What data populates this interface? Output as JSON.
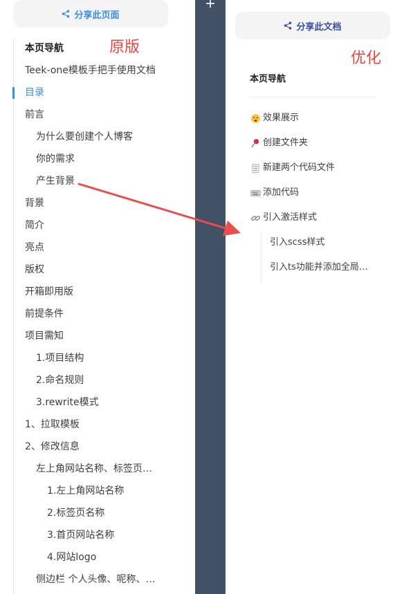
{
  "left": {
    "share_label": "分享此页面",
    "annotation_label": "原版",
    "toc": [
      {
        "label": "本页导航",
        "level": 0,
        "kind": "title"
      },
      {
        "label": "Teek-one模板手把手使用文档",
        "level": 1,
        "kind": "item"
      },
      {
        "label": "目录",
        "level": 1,
        "kind": "active"
      },
      {
        "label": "前言",
        "level": 1,
        "kind": "item"
      },
      {
        "label": "为什么要创建个人博客",
        "level": 2,
        "kind": "item"
      },
      {
        "label": "你的需求",
        "level": 2,
        "kind": "item"
      },
      {
        "label": "产生背景",
        "level": 2,
        "kind": "item"
      },
      {
        "label": "背景",
        "level": 1,
        "kind": "item"
      },
      {
        "label": "简介",
        "level": 1,
        "kind": "item"
      },
      {
        "label": "亮点",
        "level": 1,
        "kind": "item"
      },
      {
        "label": "版权",
        "level": 1,
        "kind": "item"
      },
      {
        "label": "开箱即用版",
        "level": 1,
        "kind": "item"
      },
      {
        "label": "前提条件",
        "level": 1,
        "kind": "item"
      },
      {
        "label": "项目需知",
        "level": 1,
        "kind": "item"
      },
      {
        "label": "1.项目结构",
        "level": 2,
        "kind": "item"
      },
      {
        "label": "2.命名规则",
        "level": 2,
        "kind": "item"
      },
      {
        "label": "3.rewrite模式",
        "level": 2,
        "kind": "item"
      },
      {
        "label": "1、拉取模板",
        "level": 1,
        "kind": "item"
      },
      {
        "label": "2、修改信息",
        "level": 1,
        "kind": "item"
      },
      {
        "label": "左上角网站名称、标签页…",
        "level": 2,
        "kind": "item"
      },
      {
        "label": "1.左上角网站名称",
        "level": 3,
        "kind": "item"
      },
      {
        "label": "2.标签页名称",
        "level": 3,
        "kind": "item"
      },
      {
        "label": "3.首页网站名称",
        "level": 3,
        "kind": "item"
      },
      {
        "label": "4.网站logo",
        "level": 3,
        "kind": "item"
      },
      {
        "label": "侧边栏 个人头像、呢称、…",
        "level": 2,
        "kind": "item"
      }
    ]
  },
  "right": {
    "share_label": "分享此文档",
    "annotation_label": "优化",
    "title": "本页导航",
    "toc": [
      {
        "label": "效果展示",
        "icon": "smiley-emoji-icon",
        "level": 1
      },
      {
        "label": "创建文件夹",
        "icon": "pushpin-emoji-icon",
        "level": 1
      },
      {
        "label": "新建两个代码文件",
        "icon": "page-emoji-icon",
        "level": 1
      },
      {
        "label": "添加代码",
        "icon": "keyboard-emoji-icon",
        "level": 1
      },
      {
        "label": "引入激活样式",
        "icon": "link-emoji-icon",
        "level": 1
      },
      {
        "label": "引入scss样式",
        "icon": "",
        "level": 2
      },
      {
        "label": "引入ts功能并添加全局…",
        "icon": "",
        "level": 2
      }
    ]
  },
  "colors": {
    "accent_blue": "#3b8ee0",
    "divider_band": "#435166",
    "annotation_red": "#e8453c",
    "arrow_red": "#ec4c4c"
  }
}
